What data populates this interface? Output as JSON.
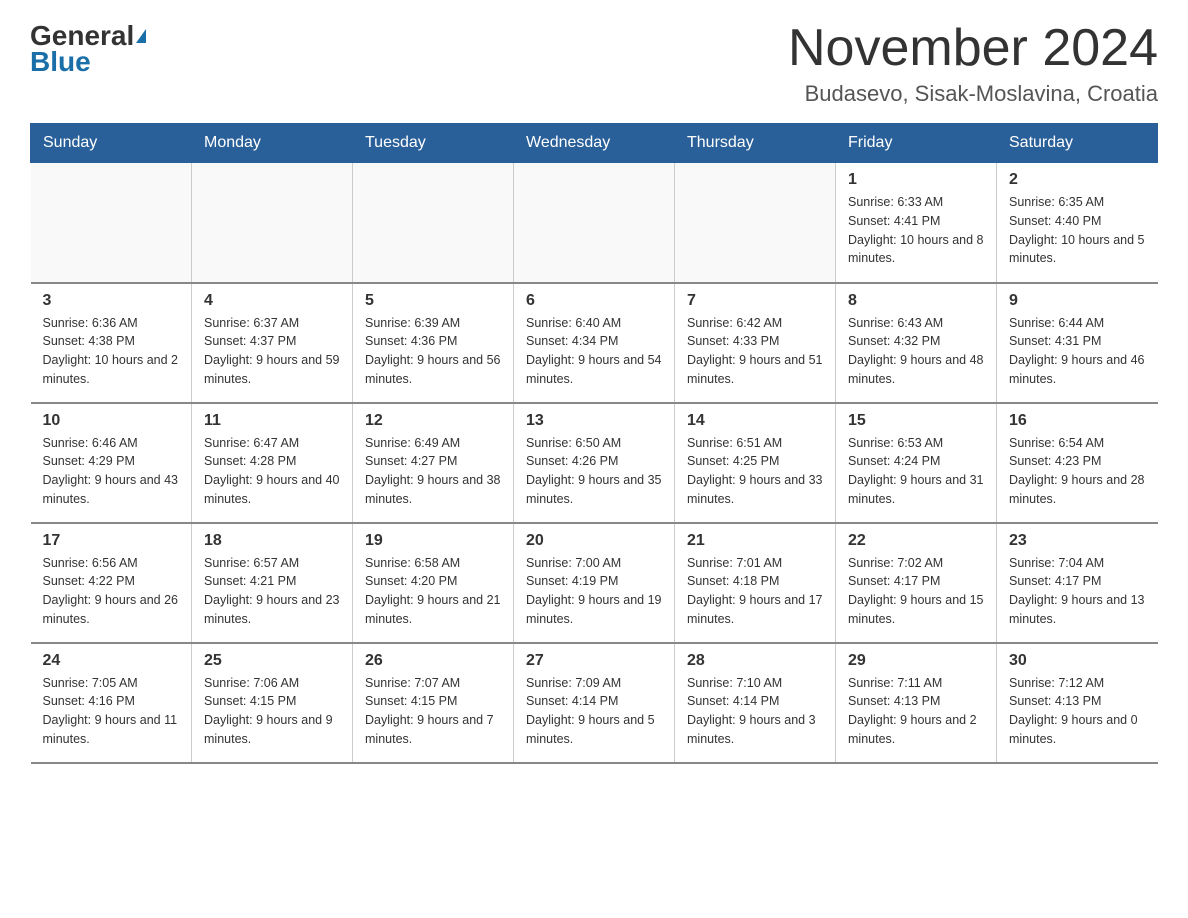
{
  "logo": {
    "general": "General",
    "blue": "Blue"
  },
  "title": "November 2024",
  "location": "Budasevo, Sisak-Moslavina, Croatia",
  "days_of_week": [
    "Sunday",
    "Monday",
    "Tuesday",
    "Wednesday",
    "Thursday",
    "Friday",
    "Saturday"
  ],
  "weeks": [
    [
      {
        "day": "",
        "info": ""
      },
      {
        "day": "",
        "info": ""
      },
      {
        "day": "",
        "info": ""
      },
      {
        "day": "",
        "info": ""
      },
      {
        "day": "",
        "info": ""
      },
      {
        "day": "1",
        "info": "Sunrise: 6:33 AM\nSunset: 4:41 PM\nDaylight: 10 hours and 8 minutes."
      },
      {
        "day": "2",
        "info": "Sunrise: 6:35 AM\nSunset: 4:40 PM\nDaylight: 10 hours and 5 minutes."
      }
    ],
    [
      {
        "day": "3",
        "info": "Sunrise: 6:36 AM\nSunset: 4:38 PM\nDaylight: 10 hours and 2 minutes."
      },
      {
        "day": "4",
        "info": "Sunrise: 6:37 AM\nSunset: 4:37 PM\nDaylight: 9 hours and 59 minutes."
      },
      {
        "day": "5",
        "info": "Sunrise: 6:39 AM\nSunset: 4:36 PM\nDaylight: 9 hours and 56 minutes."
      },
      {
        "day": "6",
        "info": "Sunrise: 6:40 AM\nSunset: 4:34 PM\nDaylight: 9 hours and 54 minutes."
      },
      {
        "day": "7",
        "info": "Sunrise: 6:42 AM\nSunset: 4:33 PM\nDaylight: 9 hours and 51 minutes."
      },
      {
        "day": "8",
        "info": "Sunrise: 6:43 AM\nSunset: 4:32 PM\nDaylight: 9 hours and 48 minutes."
      },
      {
        "day": "9",
        "info": "Sunrise: 6:44 AM\nSunset: 4:31 PM\nDaylight: 9 hours and 46 minutes."
      }
    ],
    [
      {
        "day": "10",
        "info": "Sunrise: 6:46 AM\nSunset: 4:29 PM\nDaylight: 9 hours and 43 minutes."
      },
      {
        "day": "11",
        "info": "Sunrise: 6:47 AM\nSunset: 4:28 PM\nDaylight: 9 hours and 40 minutes."
      },
      {
        "day": "12",
        "info": "Sunrise: 6:49 AM\nSunset: 4:27 PM\nDaylight: 9 hours and 38 minutes."
      },
      {
        "day": "13",
        "info": "Sunrise: 6:50 AM\nSunset: 4:26 PM\nDaylight: 9 hours and 35 minutes."
      },
      {
        "day": "14",
        "info": "Sunrise: 6:51 AM\nSunset: 4:25 PM\nDaylight: 9 hours and 33 minutes."
      },
      {
        "day": "15",
        "info": "Sunrise: 6:53 AM\nSunset: 4:24 PM\nDaylight: 9 hours and 31 minutes."
      },
      {
        "day": "16",
        "info": "Sunrise: 6:54 AM\nSunset: 4:23 PM\nDaylight: 9 hours and 28 minutes."
      }
    ],
    [
      {
        "day": "17",
        "info": "Sunrise: 6:56 AM\nSunset: 4:22 PM\nDaylight: 9 hours and 26 minutes."
      },
      {
        "day": "18",
        "info": "Sunrise: 6:57 AM\nSunset: 4:21 PM\nDaylight: 9 hours and 23 minutes."
      },
      {
        "day": "19",
        "info": "Sunrise: 6:58 AM\nSunset: 4:20 PM\nDaylight: 9 hours and 21 minutes."
      },
      {
        "day": "20",
        "info": "Sunrise: 7:00 AM\nSunset: 4:19 PM\nDaylight: 9 hours and 19 minutes."
      },
      {
        "day": "21",
        "info": "Sunrise: 7:01 AM\nSunset: 4:18 PM\nDaylight: 9 hours and 17 minutes."
      },
      {
        "day": "22",
        "info": "Sunrise: 7:02 AM\nSunset: 4:17 PM\nDaylight: 9 hours and 15 minutes."
      },
      {
        "day": "23",
        "info": "Sunrise: 7:04 AM\nSunset: 4:17 PM\nDaylight: 9 hours and 13 minutes."
      }
    ],
    [
      {
        "day": "24",
        "info": "Sunrise: 7:05 AM\nSunset: 4:16 PM\nDaylight: 9 hours and 11 minutes."
      },
      {
        "day": "25",
        "info": "Sunrise: 7:06 AM\nSunset: 4:15 PM\nDaylight: 9 hours and 9 minutes."
      },
      {
        "day": "26",
        "info": "Sunrise: 7:07 AM\nSunset: 4:15 PM\nDaylight: 9 hours and 7 minutes."
      },
      {
        "day": "27",
        "info": "Sunrise: 7:09 AM\nSunset: 4:14 PM\nDaylight: 9 hours and 5 minutes."
      },
      {
        "day": "28",
        "info": "Sunrise: 7:10 AM\nSunset: 4:14 PM\nDaylight: 9 hours and 3 minutes."
      },
      {
        "day": "29",
        "info": "Sunrise: 7:11 AM\nSunset: 4:13 PM\nDaylight: 9 hours and 2 minutes."
      },
      {
        "day": "30",
        "info": "Sunrise: 7:12 AM\nSunset: 4:13 PM\nDaylight: 9 hours and 0 minutes."
      }
    ]
  ]
}
